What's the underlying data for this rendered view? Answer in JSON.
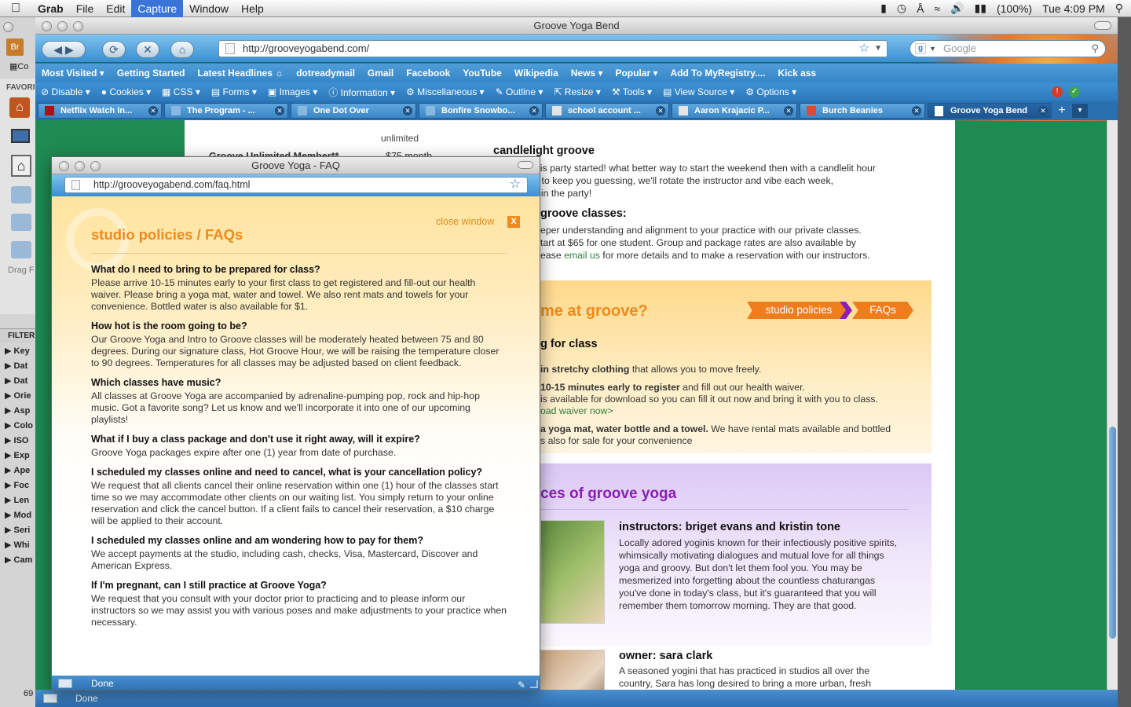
{
  "menubar": {
    "app": "Grab",
    "items": [
      "File",
      "Edit",
      "Capture",
      "Window",
      "Help"
    ],
    "active": "Capture",
    "battery": "(100%)",
    "clock": "Tue 4:09 PM"
  },
  "bridge": {
    "top_labels": [
      "Br",
      "Co",
      "FAVORI",
      "Drag F"
    ],
    "filter_label": "FILTER",
    "filter_items": [
      "Key",
      "Dat",
      "Dat",
      "Orie",
      "Asp",
      "Colo",
      "ISO",
      "Exp",
      "Ape",
      "Foc",
      "Len",
      "Mod",
      "Seri",
      "Whi",
      "Cam"
    ],
    "bottom_count": "69"
  },
  "main_window": {
    "title": "Groove Yoga Bend",
    "url": "http://grooveyogabend.com/",
    "search_placeholder": "Google",
    "bookmarks": [
      "Most Visited",
      "Getting Started",
      "Latest Headlines",
      "dotreadymail",
      "Gmail",
      "Facebook",
      "YouTube",
      "Wikipedia",
      "News",
      "Popular",
      "Add To MyRegistry....",
      "Kick ass"
    ],
    "devbar": [
      "Disable",
      "Cookies",
      "CSS",
      "Forms",
      "Images",
      "Information",
      "Miscellaneous",
      "Outline",
      "Resize",
      "Tools",
      "View Source",
      "Options"
    ],
    "tabs": [
      {
        "label": "Netflix Watch In..."
      },
      {
        "label": "The Program - ..."
      },
      {
        "label": "One Dot Over"
      },
      {
        "label": "Bonfire Snowbo..."
      },
      {
        "label": "school account ..."
      },
      {
        "label": "Aaron Krajacic P..."
      },
      {
        "label": "Burch Beanies"
      },
      {
        "label": "Groove Yoga Bend"
      }
    ],
    "status": "Done"
  },
  "page": {
    "pricing": {
      "partial_top": "unlimited",
      "row_label": "Groove Unlimited Member**",
      "row_price": "$75 month"
    },
    "candlelight": {
      "heading": "candlelight groove",
      "text": "Let's get this party started! what better way to start the weekend then with a candlelit hour",
      "text2": "yoga? And to keep you guessing, we'll rotate the instructor and vibe each week,",
      "text3": "date and join the party!"
    },
    "private": {
      "heading": "groove classes:",
      "line1": "eper understanding and alignment to your practice with our private classes.",
      "line2": "tart at $65 for one student. Group and package rates are also available by",
      "line3_pre": "ease ",
      "line3_link": "email us",
      "line3_post": " for more details and to make a reservation with our instructors."
    },
    "first_time": {
      "heading": "me at groove?",
      "btn_policies": "studio policies",
      "btn_faqs": "FAQs",
      "sub": "g for class",
      "b1_bold": "in stretchy clothing",
      "b1_rest": " that allows you to move freely.",
      "b2_bold": "10-15 minutes early to register",
      "b2_rest": " and fill out our health waiver.",
      "b2_line2": "is available for download so you can fill it out now and bring it with you to class.",
      "b2_link": "oad waiver now>",
      "b3_bold": "a yoga mat, water bottle and a towel.",
      "b3_rest": " We have rental mats available and bottled",
      "b3_line2": "s also for sale for your convenience"
    },
    "faces": {
      "heading": "ces of groove yoga",
      "inst_heading": "instructors: briget evans and kristin tone",
      "inst_text": "Locally adored yoginis known for their infectiously positive spirits, whimsically motivating dialogues and mutual love for all things yoga and groovy. But don't let them fool you. You may be mesmerized into forgetting about the countless chaturangas you've done in today's class, but it's guaranteed that you will remember them tomorrow morning. They are that good.",
      "owner_heading": "owner: sara clark",
      "owner_text": "A seasoned yogini that has practiced in studios all over the country, Sara has long desired to bring a more urban, fresh offering to Bend's yoga scene..... classes that are fun, upbeat, challenging and most of all, an amazing workout. After"
    }
  },
  "popup": {
    "title": "Groove Yoga - FAQ",
    "url": "http://grooveyogabend.com/faq.html",
    "close_label": "close window",
    "close_x": "X",
    "heading": "studio policies / FAQs",
    "faqs": [
      {
        "q": "What do I need to bring to be prepared for class?",
        "a": "Please arrive 10-15 minutes early to your first class to get registered and fill-out our health waiver. Please bring a yoga mat, water and towel. We also rent mats and towels for your convenience. Bottled water is also available for $1."
      },
      {
        "q": "How hot is the room going to be?",
        "a": "Our Groove Yoga and Intro to Groove classes will be moderately heated between 75 and 80 degrees. During our signature class, Hot Groove Hour, we will be raising the temperature closer to 90 degrees. Temperatures for all classes may be adjusted based on client feedback."
      },
      {
        "q": "Which classes have music?",
        "a": "All classes at Groove Yoga are accompanied by adrenaline-pumping pop, rock and hip-hop music. Got a favorite song? Let us know and we'll incorporate it into one of our upcoming playlists!"
      },
      {
        "q": "What if I buy a class package and don't use it right away, will it expire?",
        "a": "Groove Yoga packages expire after one (1) year from date of purchase."
      },
      {
        "q": "I scheduled my classes online and need to cancel, what is your cancellation policy?",
        "a": "We request that all clients cancel their online reservation within one (1) hour of the classes start time so we may accommodate other clients on our waiting list. You simply return to your online reservation and click the cancel button. If a client fails to cancel their reservation, a $10 charge will be applied to their account."
      },
      {
        "q": "I scheduled my classes online and am wondering how to pay for them?",
        "a": "We accept payments at the studio, including cash, checks, Visa, Mastercard, Discover and American Express."
      },
      {
        "q": "If I'm pregnant, can I still practice at Groove Yoga?",
        "a": "We request that you consult with your doctor prior to practicing and to please inform our instructors so we may assist you with various poses and make adjustments to your practice when necessary."
      }
    ],
    "status": "Done"
  },
  "colors": {
    "orange": "#f08a1c",
    "purple": "#8a1fb5",
    "green_bg": "#1f8a52",
    "link_green": "#2f7f3b"
  }
}
